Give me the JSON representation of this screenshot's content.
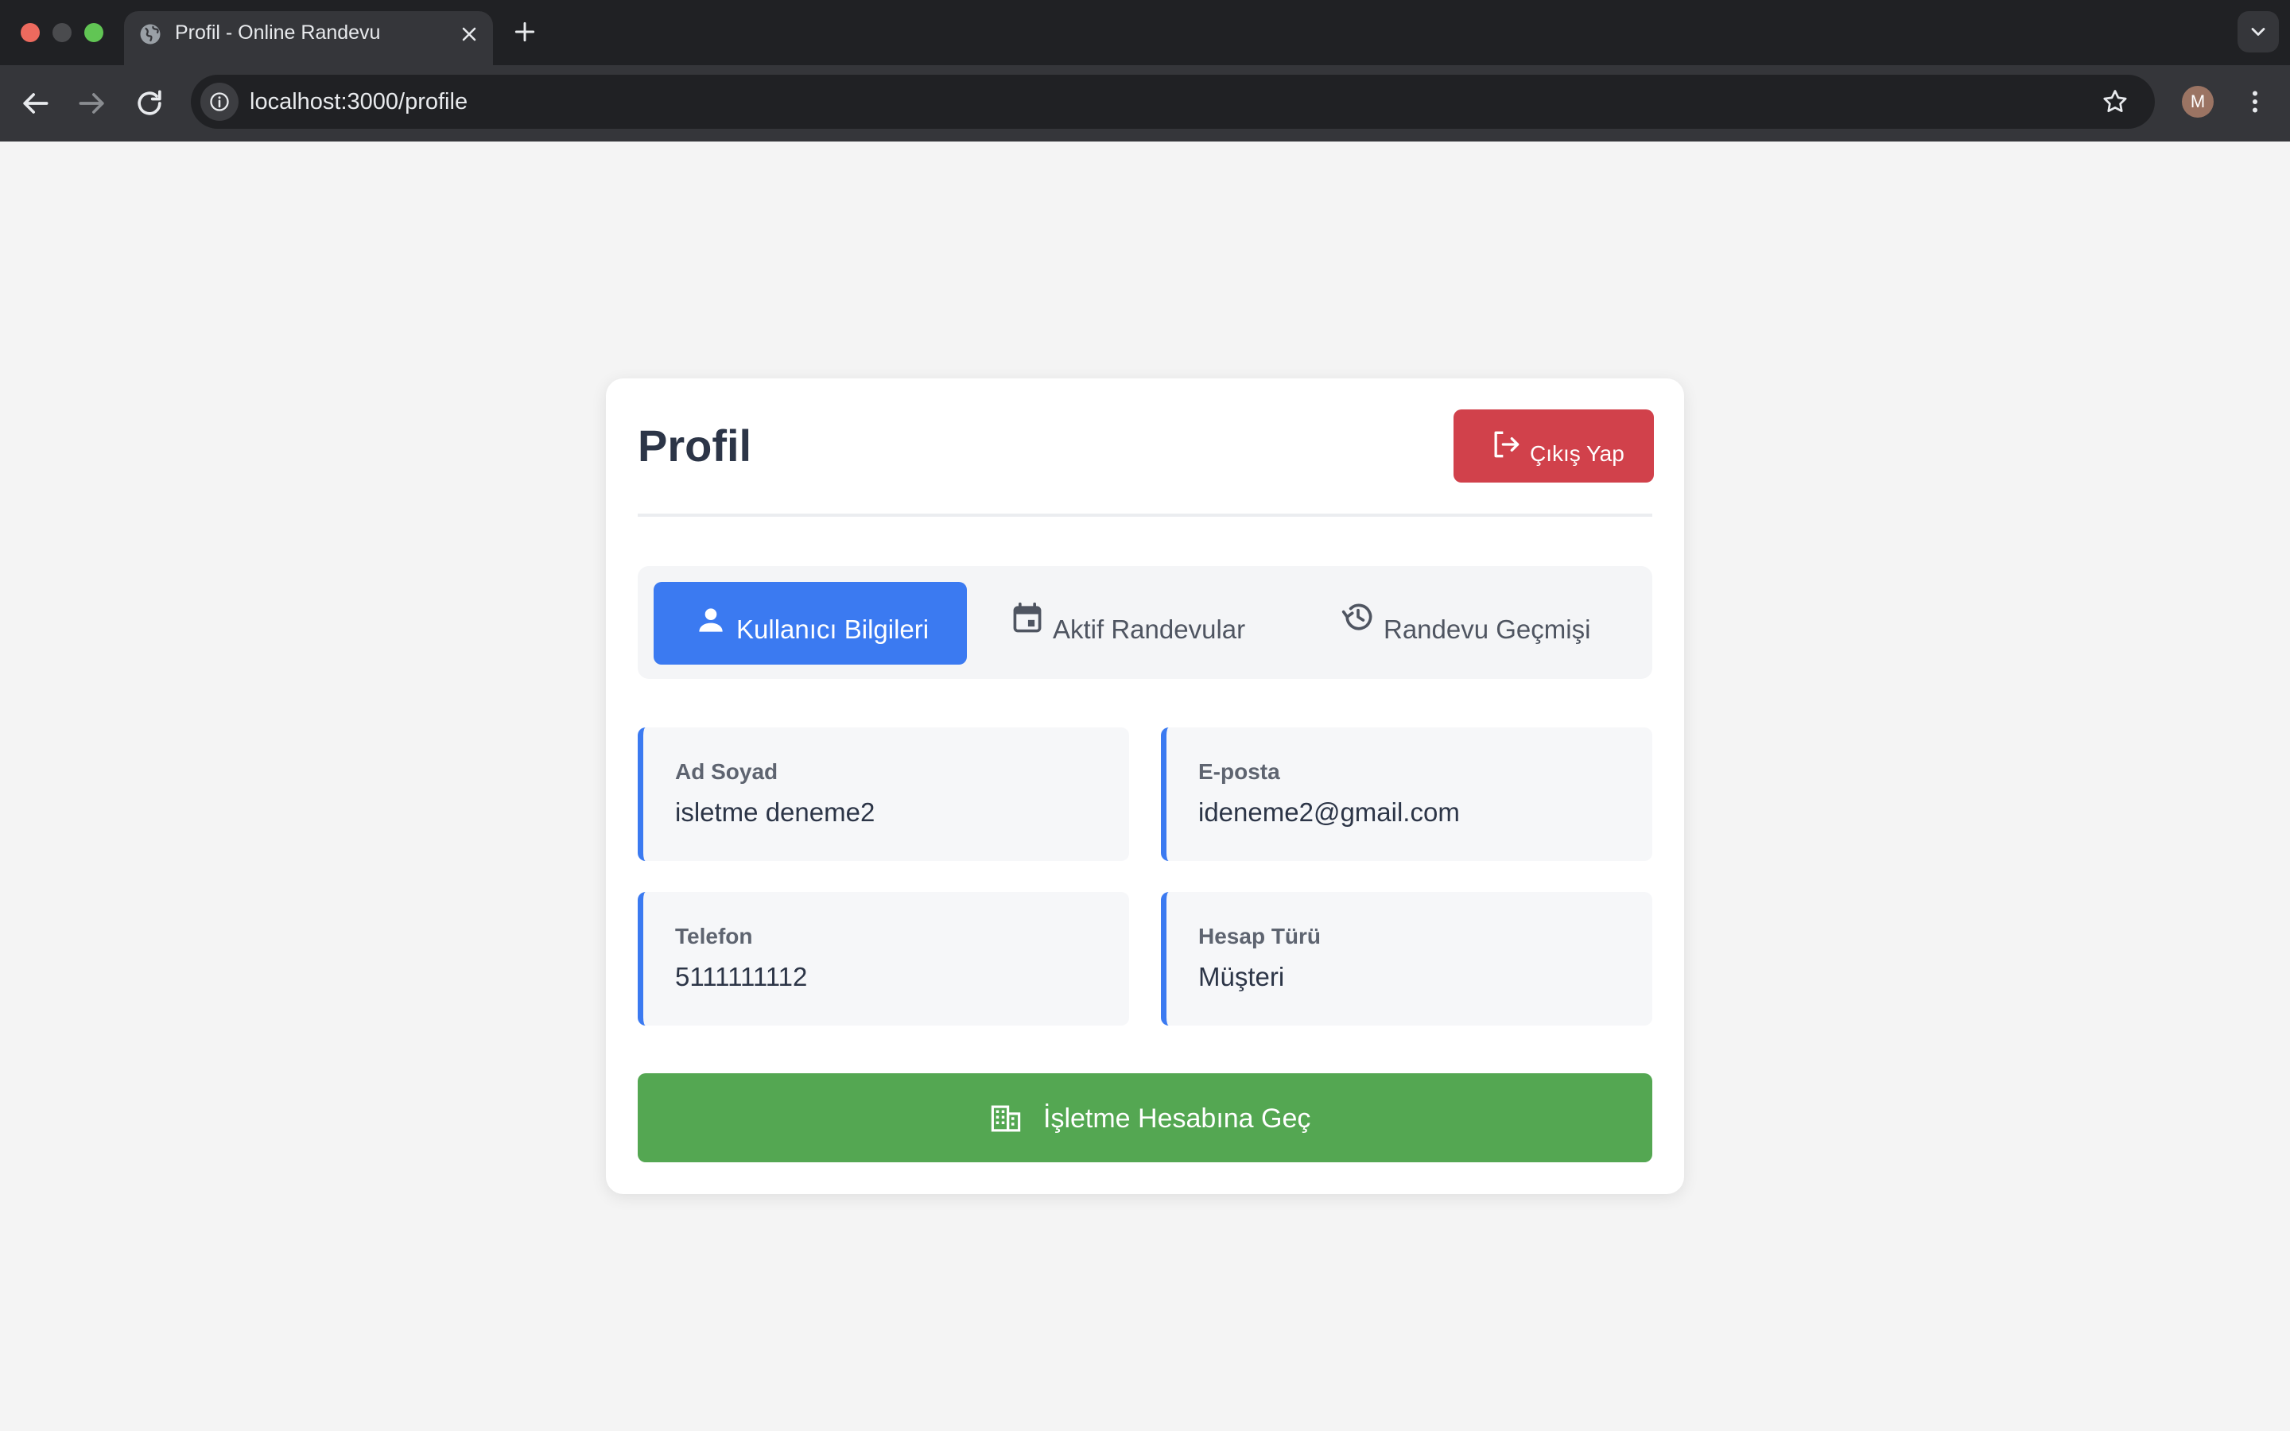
{
  "browser": {
    "tab_title": "Profil - Online Randevu",
    "url": "localhost:3000/profile",
    "profile_initial": "M"
  },
  "profile": {
    "title": "Profil",
    "logout_label": "Çıkış Yap",
    "tabs": [
      {
        "label": "Kullanıcı Bilgileri",
        "icon": "person-icon",
        "active": true
      },
      {
        "label": "Aktif Randevular",
        "icon": "calendar-icon",
        "active": false
      },
      {
        "label": "Randevu Geçmişi",
        "icon": "history-icon",
        "active": false
      }
    ],
    "fields": {
      "name": {
        "label": "Ad Soyad",
        "value": "isletme deneme2"
      },
      "email": {
        "label": "E-posta",
        "value": "ideneme2@gmail.com"
      },
      "phone": {
        "label": "Telefon",
        "value": "5111111112"
      },
      "account_type": {
        "label": "Hesap Türü",
        "value": "Müşteri"
      }
    },
    "switch_business_label": "İşletme Hesabına Geç"
  },
  "colors": {
    "primary": "#3b7af1",
    "danger": "#d1414b",
    "success": "#54a752",
    "heading": "#2c3547"
  }
}
